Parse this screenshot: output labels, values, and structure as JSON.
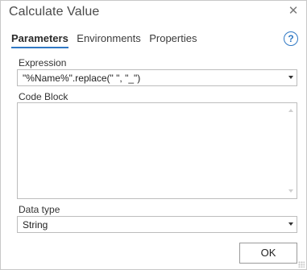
{
  "window": {
    "title": "Calculate Value"
  },
  "tabs": [
    {
      "label": "Parameters",
      "active": true
    },
    {
      "label": "Environments",
      "active": false
    },
    {
      "label": "Properties",
      "active": false
    }
  ],
  "help_label": "?",
  "form": {
    "expression": {
      "label": "Expression",
      "value": "\"%Name%\".replace(\" \", \"_\")"
    },
    "code_block": {
      "label": "Code Block",
      "value": ""
    },
    "data_type": {
      "label": "Data type",
      "value": "String"
    }
  },
  "buttons": {
    "ok_label": "OK"
  },
  "icons": {
    "close": "close-icon",
    "help": "help-icon",
    "dropdown": "chevron-down-icon"
  },
  "colors": {
    "accent": "#2f78c4",
    "border": "#bdbdbd"
  }
}
